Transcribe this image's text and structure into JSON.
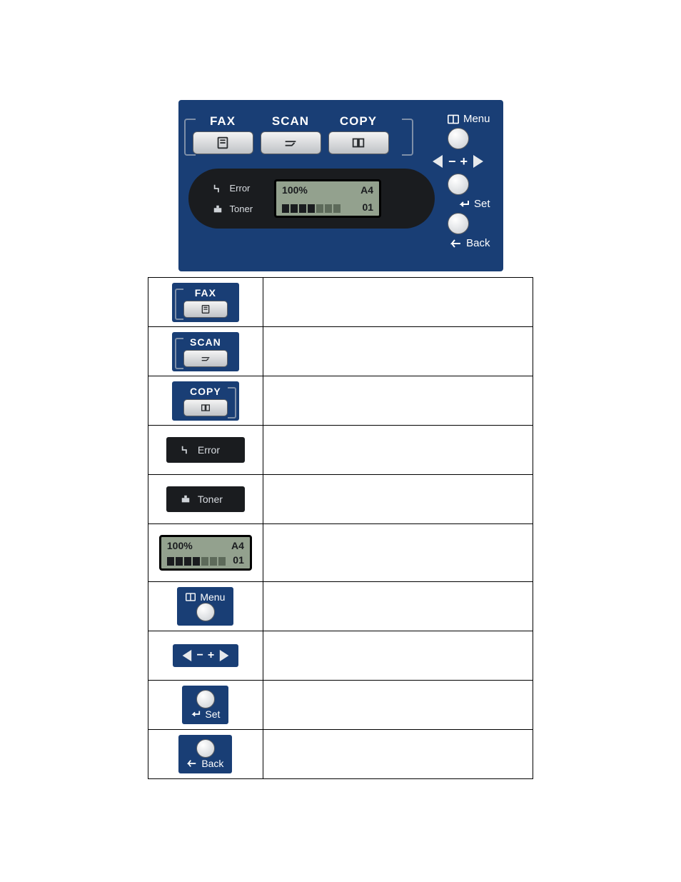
{
  "panel": {
    "modes": {
      "fax": "FAX",
      "scan": "SCAN",
      "copy": "COPY"
    },
    "status": {
      "error": "Error",
      "toner": "Toner",
      "lcd": {
        "zoom": "100%",
        "paper": "A4",
        "copies": "01",
        "bars_on": 4,
        "bars_total": 7
      }
    },
    "nav": {
      "menu": "Menu",
      "minus": "−",
      "plus": "+",
      "set": "Set",
      "back": "Back"
    }
  },
  "legend": [
    {
      "key": "fax"
    },
    {
      "key": "scan"
    },
    {
      "key": "copy"
    },
    {
      "key": "error"
    },
    {
      "key": "toner"
    },
    {
      "key": "lcd"
    },
    {
      "key": "menu"
    },
    {
      "key": "lr"
    },
    {
      "key": "set"
    },
    {
      "key": "back"
    }
  ]
}
